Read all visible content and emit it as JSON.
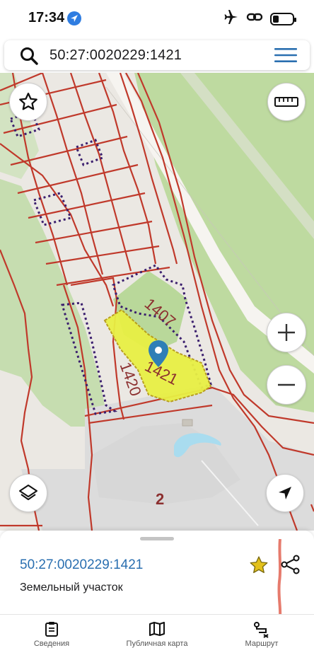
{
  "status_bar": {
    "time": "17:34",
    "icons": [
      "location-arrow-icon",
      "airplane-icon",
      "link-icon",
      "battery-icon"
    ],
    "battery_level": 0.3
  },
  "search": {
    "query": "50:27:0020229:1421",
    "icons": [
      "search-icon",
      "hamburger-menu-icon"
    ]
  },
  "map": {
    "plot_labels": {
      "selected": "1421",
      "north": "1407",
      "west": "1420",
      "zone": "2"
    },
    "colors": {
      "parcel_border": "#c0392b",
      "selected_fill": "#e8f044",
      "dotted_border": "#3b1f6e",
      "marker": "#2f7fb6",
      "forest": "#bedaa0",
      "road": "#f4f2ee",
      "water": "#a9dcef"
    },
    "controls": [
      "favorite-star-icon",
      "ruler-icon",
      "zoom-in-icon",
      "zoom-out-icon",
      "layers-icon",
      "navigation-arrow-icon"
    ]
  },
  "card": {
    "title": "50:27:0020229:1421",
    "subtitle": "Земельный участок",
    "accent": "#2a6fb0",
    "star_color": "#e3c11b"
  },
  "tabs": [
    {
      "label": "Сведения",
      "icon": "clipboard-icon"
    },
    {
      "label": "Публичная карта",
      "icon": "map-icon"
    },
    {
      "label": "Маршрут",
      "icon": "route-icon"
    }
  ]
}
